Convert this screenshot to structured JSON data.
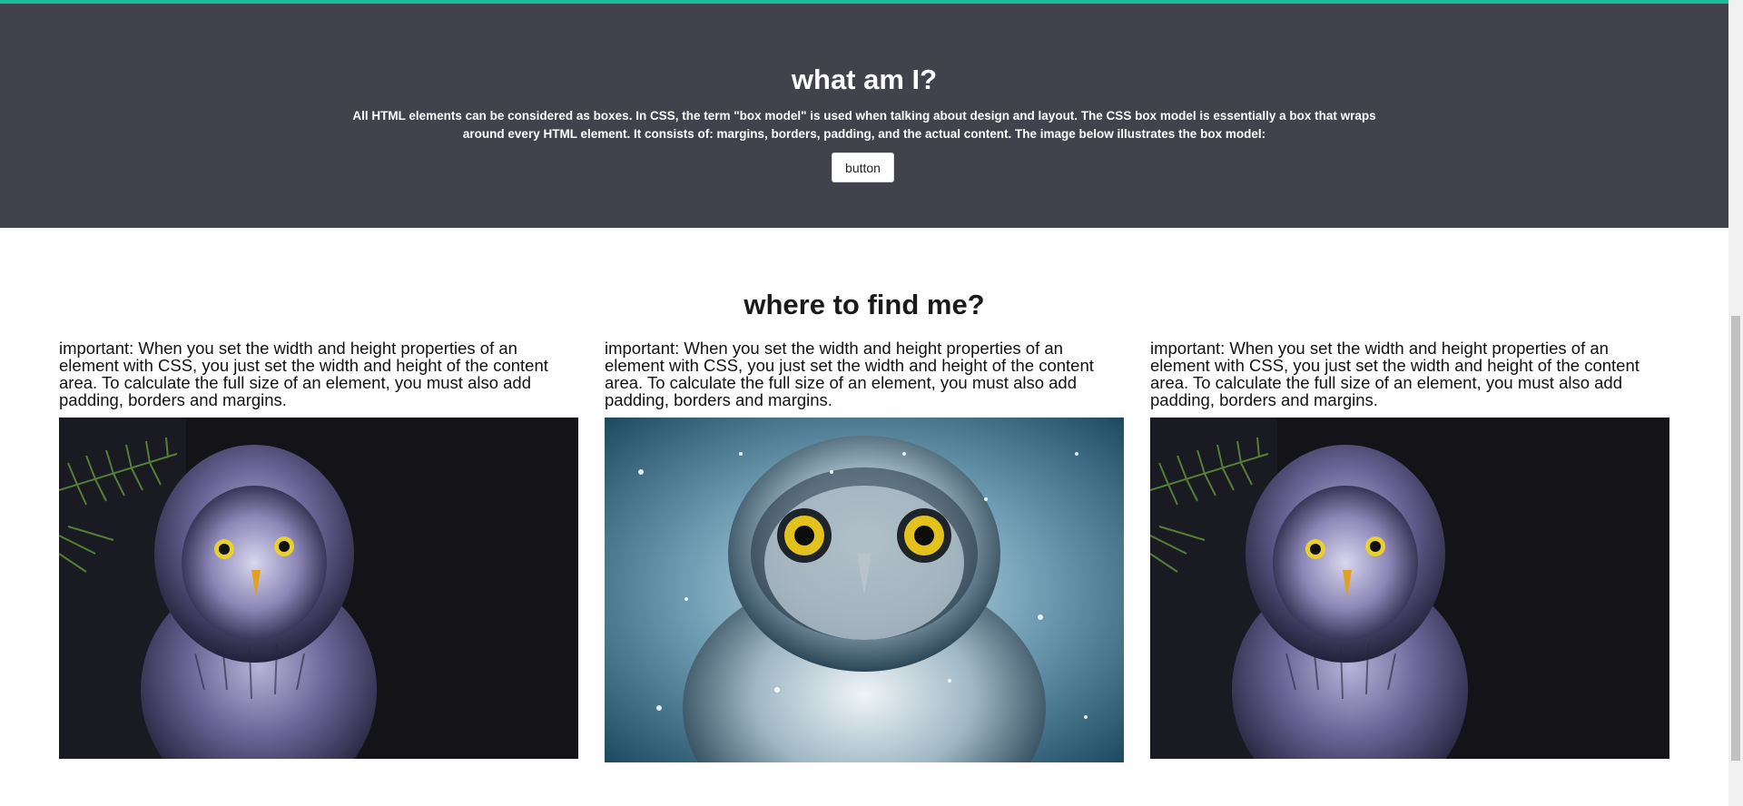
{
  "hero": {
    "title": "what am I?",
    "description": "All HTML elements can be considered as boxes. In CSS, the term \"box model\" is used when talking about design and layout. The CSS box model is essentially a box that wraps around every HTML element. It consists of: margins, borders, padding, and the actual content. The image below illustrates the box model:",
    "button_label": "button"
  },
  "find": {
    "title": "where to find me?",
    "cards": [
      {
        "text": "important: When you set the width and height properties of an element with CSS, you just set the width and height of the content area. To calculate the full size of an element, you must also add padding, borders and margins.",
        "image": "great-grey-owl-dark"
      },
      {
        "text": "important: When you set the width and height properties of an element with CSS, you just set the width and height of the content area. To calculate the full size of an element, you must also add padding, borders and margins.",
        "image": "snowy-owl-blue"
      },
      {
        "text": "important: When you set the width and height properties of an element with CSS, you just set the width and height of the content area. To calculate the full size of an element, you must also add padding, borders and margins.",
        "image": "great-grey-owl-dark"
      }
    ]
  },
  "colors": {
    "accent": "#1abc9c",
    "hero_bg": "#42424c",
    "page_bg": "#ffffff"
  }
}
